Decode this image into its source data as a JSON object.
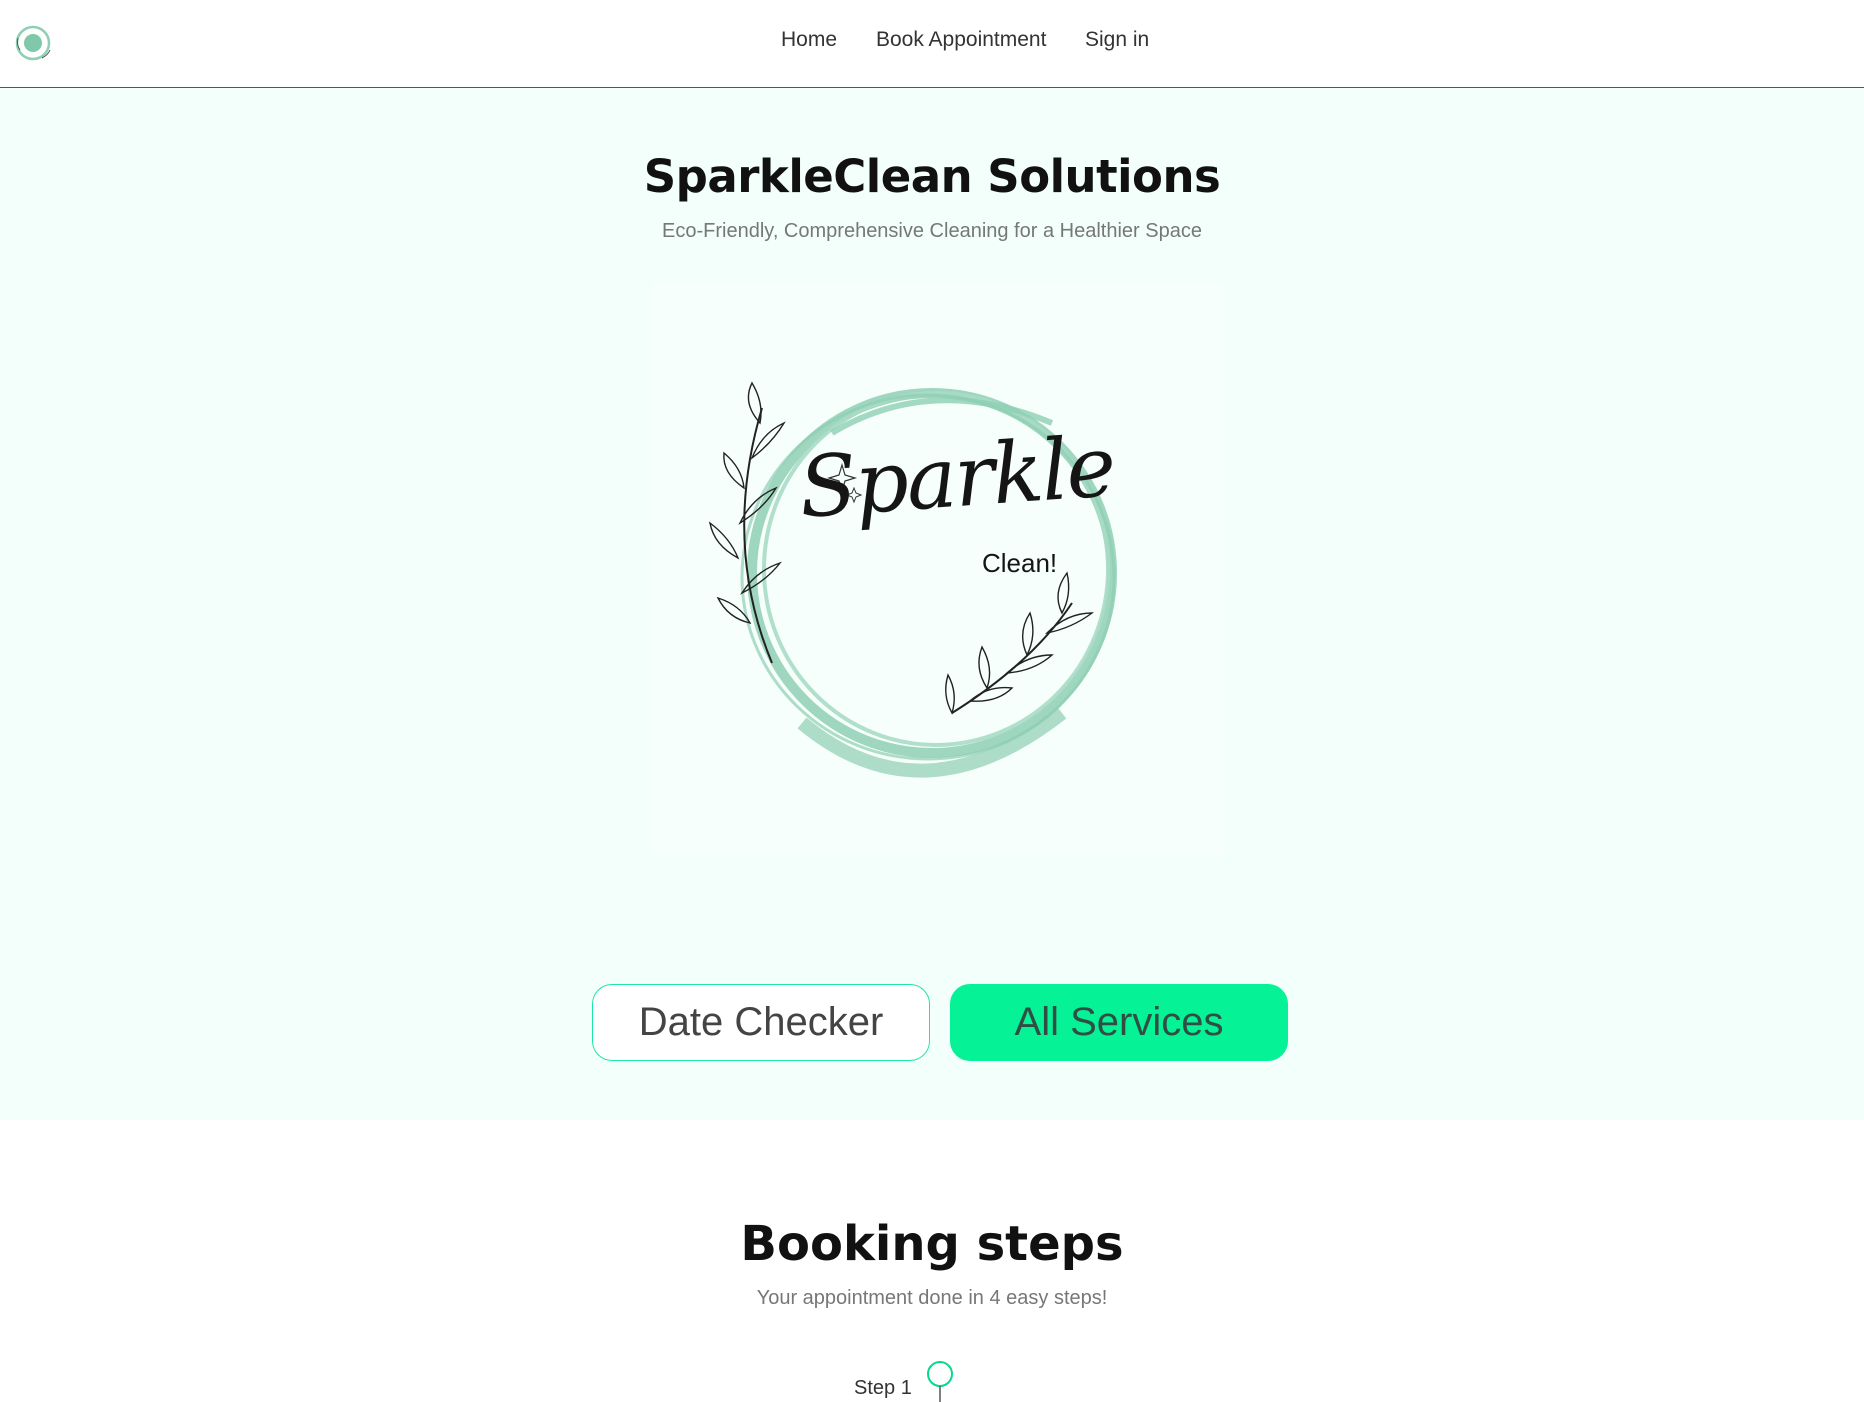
{
  "nav": {
    "links": [
      {
        "label": "Home"
      },
      {
        "label": "Book Appointment"
      },
      {
        "label": "Sign in"
      }
    ],
    "logo_icon": "sparkle-logo-icon"
  },
  "hero": {
    "title": "SparkleClean Solutions",
    "subtitle": "Eco-Friendly, Comprehensive Cleaning for a Healthier Space",
    "logo": {
      "word": "Sparkle",
      "sub": "Clean!"
    },
    "buttons": {
      "date_checker": "Date Checker",
      "all_services": "All Services"
    }
  },
  "steps": {
    "title": "Booking steps",
    "subtitle": "Your appointment done in 4 easy steps!",
    "items": [
      {
        "label": "Step 1"
      }
    ]
  },
  "colors": {
    "hero_bg": "#f2fffa",
    "accent": "#06f297",
    "accent_outline": "#1ee8a0",
    "wreath_green": "#8fcfb4"
  }
}
